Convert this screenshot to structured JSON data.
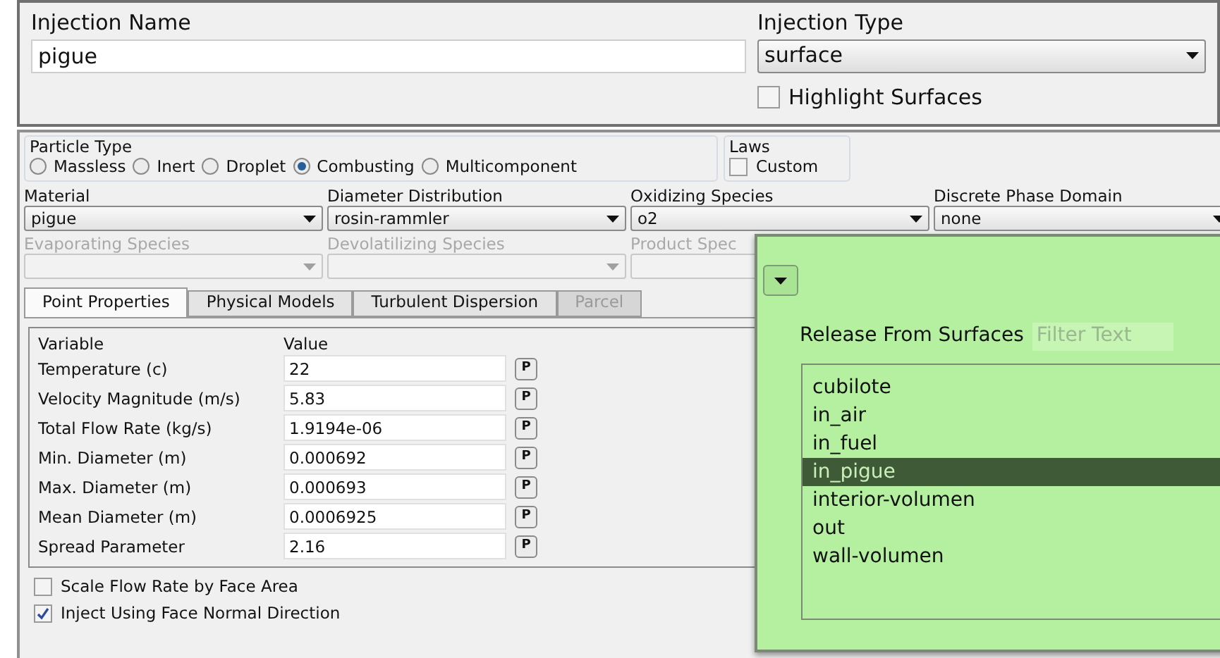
{
  "injection_name": {
    "label": "Injection Name",
    "value": "pigue"
  },
  "injection_type": {
    "label": "Injection Type",
    "value": "surface"
  },
  "highlight_surfaces": {
    "label": "Highlight Surfaces",
    "checked": false
  },
  "particle_type": {
    "title": "Particle Type",
    "options": [
      {
        "label": "Massless",
        "selected": false
      },
      {
        "label": "Inert",
        "selected": false
      },
      {
        "label": "Droplet",
        "selected": false
      },
      {
        "label": "Combusting",
        "selected": true
      },
      {
        "label": "Multicomponent",
        "selected": false
      }
    ]
  },
  "laws": {
    "title": "Laws",
    "custom": {
      "label": "Custom",
      "checked": false
    }
  },
  "selectors": [
    {
      "label": "Material",
      "value": "pigue",
      "disabled": false
    },
    {
      "label": "Diameter Distribution",
      "value": "rosin-rammler",
      "disabled": false
    },
    {
      "label": "Oxidizing Species",
      "value": "o2",
      "disabled": false
    },
    {
      "label": "Discrete Phase Domain",
      "value": "none",
      "disabled": false
    },
    {
      "label": "Evaporating Species",
      "disabled": true
    },
    {
      "label": "Devolatilizing Species",
      "disabled": true
    },
    {
      "label": "Product Spec",
      "disabled": true
    }
  ],
  "tabs": [
    {
      "label": "Point Properties",
      "selected": true,
      "disabled": false
    },
    {
      "label": "Physical Models",
      "selected": false,
      "disabled": false
    },
    {
      "label": "Turbulent Dispersion",
      "selected": false,
      "disabled": false
    },
    {
      "label": "Parcel",
      "selected": false,
      "disabled": true
    }
  ],
  "properties": {
    "columns": [
      "Variable",
      "Value"
    ],
    "rows": [
      {
        "variable": "Temperature (c)",
        "value": "22",
        "button": "P"
      },
      {
        "variable": "Velocity Magnitude (m/s)",
        "value": "5.83",
        "button": "P"
      },
      {
        "variable": "Total Flow Rate (kg/s)",
        "value": "1.9194e-06",
        "button": "P"
      },
      {
        "variable": "Min. Diameter (m)",
        "value": "0.000692",
        "button": "P"
      },
      {
        "variable": "Max. Diameter (m)",
        "value": "0.000693",
        "button": "P"
      },
      {
        "variable": "Mean Diameter (m)",
        "value": "0.0006925",
        "button": "P"
      },
      {
        "variable": "Spread Parameter",
        "value": "2.16",
        "button": "P"
      }
    ]
  },
  "options": [
    {
      "label": "Scale Flow Rate by Face Area",
      "checked": false
    },
    {
      "label": "Inject Using Face Normal Direction",
      "checked": true
    }
  ],
  "release_popup": {
    "title": "Release From Surfaces",
    "filter_placeholder": "Filter Text",
    "surfaces": [
      {
        "label": "cubilote",
        "selected": false
      },
      {
        "label": "in_air",
        "selected": false
      },
      {
        "label": "in_fuel",
        "selected": false
      },
      {
        "label": "in_pigue",
        "selected": true
      },
      {
        "label": "interior-volumen",
        "selected": false
      },
      {
        "label": "out",
        "selected": false
      },
      {
        "label": "wall-volumen",
        "selected": false
      }
    ]
  }
}
